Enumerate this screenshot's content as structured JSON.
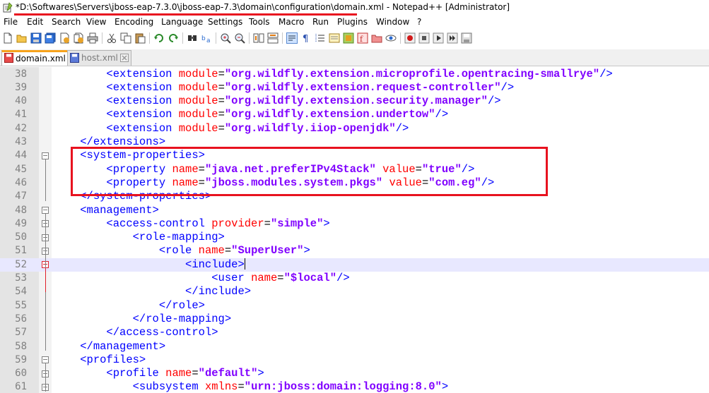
{
  "window": {
    "title": "*D:\\Softwares\\Servers\\jboss-eap-7.3.0\\jboss-eap-7.3\\domain\\configuration\\domain.xml - Notepad++ [Administrator]"
  },
  "menu": [
    "File",
    "Edit",
    "Search",
    "View",
    "Encoding",
    "Language",
    "Settings",
    "Tools",
    "Macro",
    "Run",
    "Plugins",
    "Window",
    "?"
  ],
  "tabs": [
    {
      "label": "domain.xml",
      "active": true
    },
    {
      "label": "host.xml",
      "active": false
    }
  ],
  "editor": {
    "current_line": "52",
    "lines": [
      {
        "n": "38",
        "indent": "        ",
        "parts": [
          [
            "tg",
            "<extension "
          ],
          [
            "at",
            "module"
          ],
          [
            "pl",
            "="
          ],
          [
            "vl",
            "\"org.wildfly.extension.microprofile.opentracing-smallrye\""
          ],
          [
            "tg",
            "/>"
          ]
        ]
      },
      {
        "n": "39",
        "indent": "        ",
        "parts": [
          [
            "tg",
            "<extension "
          ],
          [
            "at",
            "module"
          ],
          [
            "pl",
            "="
          ],
          [
            "vl",
            "\"org.wildfly.extension.request-controller\""
          ],
          [
            "tg",
            "/>"
          ]
        ]
      },
      {
        "n": "40",
        "indent": "        ",
        "parts": [
          [
            "tg",
            "<extension "
          ],
          [
            "at",
            "module"
          ],
          [
            "pl",
            "="
          ],
          [
            "vl",
            "\"org.wildfly.extension.security.manager\""
          ],
          [
            "tg",
            "/>"
          ]
        ]
      },
      {
        "n": "41",
        "indent": "        ",
        "parts": [
          [
            "tg",
            "<extension "
          ],
          [
            "at",
            "module"
          ],
          [
            "pl",
            "="
          ],
          [
            "vl",
            "\"org.wildfly.extension.undertow\""
          ],
          [
            "tg",
            "/>"
          ]
        ]
      },
      {
        "n": "42",
        "indent": "        ",
        "parts": [
          [
            "tg",
            "<extension "
          ],
          [
            "at",
            "module"
          ],
          [
            "pl",
            "="
          ],
          [
            "vl",
            "\"org.wildfly.iiop-openjdk\""
          ],
          [
            "tg",
            "/>"
          ]
        ]
      },
      {
        "n": "43",
        "indent": "    ",
        "parts": [
          [
            "tg",
            "</extensions>"
          ]
        ]
      },
      {
        "n": "44",
        "indent": "    ",
        "parts": [
          [
            "tg",
            "<system-properties>"
          ]
        ]
      },
      {
        "n": "45",
        "indent": "        ",
        "parts": [
          [
            "tg",
            "<property "
          ],
          [
            "at",
            "name"
          ],
          [
            "pl",
            "="
          ],
          [
            "vl",
            "\"java.net.preferIPv4Stack\""
          ],
          [
            "tg",
            " "
          ],
          [
            "at",
            "value"
          ],
          [
            "pl",
            "="
          ],
          [
            "vl",
            "\"true\""
          ],
          [
            "tg",
            "/>"
          ]
        ]
      },
      {
        "n": "46",
        "indent": "        ",
        "parts": [
          [
            "tg",
            "<property "
          ],
          [
            "at",
            "name"
          ],
          [
            "pl",
            "="
          ],
          [
            "vl",
            "\"jboss.modules.system.pkgs\""
          ],
          [
            "tg",
            " "
          ],
          [
            "at",
            "value"
          ],
          [
            "pl",
            "="
          ],
          [
            "vl",
            "\"com.eg\""
          ],
          [
            "tg",
            "/>"
          ]
        ]
      },
      {
        "n": "47",
        "indent": "    ",
        "parts": [
          [
            "tg",
            "</system-properties>"
          ]
        ]
      },
      {
        "n": "48",
        "indent": "    ",
        "parts": [
          [
            "tg",
            "<management>"
          ]
        ]
      },
      {
        "n": "49",
        "indent": "        ",
        "parts": [
          [
            "tg",
            "<access-control "
          ],
          [
            "at",
            "provider"
          ],
          [
            "pl",
            "="
          ],
          [
            "vl",
            "\"simple\""
          ],
          [
            "tg",
            ">"
          ]
        ]
      },
      {
        "n": "50",
        "indent": "            ",
        "parts": [
          [
            "tg",
            "<role-mapping>"
          ]
        ]
      },
      {
        "n": "51",
        "indent": "                ",
        "parts": [
          [
            "tg",
            "<role "
          ],
          [
            "at",
            "name"
          ],
          [
            "pl",
            "="
          ],
          [
            "vl",
            "\"SuperUser\""
          ],
          [
            "tg",
            ">"
          ]
        ]
      },
      {
        "n": "52",
        "indent": "                    ",
        "parts": [
          [
            "tg",
            "<include>"
          ]
        ]
      },
      {
        "n": "53",
        "indent": "                        ",
        "parts": [
          [
            "tg",
            "<user "
          ],
          [
            "at",
            "name"
          ],
          [
            "pl",
            "="
          ],
          [
            "vl",
            "\"$local\""
          ],
          [
            "tg",
            "/>"
          ]
        ]
      },
      {
        "n": "54",
        "indent": "                    ",
        "parts": [
          [
            "tg",
            "</include>"
          ]
        ]
      },
      {
        "n": "55",
        "indent": "                ",
        "parts": [
          [
            "tg",
            "</role>"
          ]
        ]
      },
      {
        "n": "56",
        "indent": "            ",
        "parts": [
          [
            "tg",
            "</role-mapping>"
          ]
        ]
      },
      {
        "n": "57",
        "indent": "        ",
        "parts": [
          [
            "tg",
            "</access-control>"
          ]
        ]
      },
      {
        "n": "58",
        "indent": "    ",
        "parts": [
          [
            "tg",
            "</management>"
          ]
        ]
      },
      {
        "n": "59",
        "indent": "    ",
        "parts": [
          [
            "tg",
            "<profiles>"
          ]
        ]
      },
      {
        "n": "60",
        "indent": "        ",
        "parts": [
          [
            "tg",
            "<profile "
          ],
          [
            "at",
            "name"
          ],
          [
            "pl",
            "="
          ],
          [
            "vl",
            "\"default\""
          ],
          [
            "tg",
            ">"
          ]
        ]
      },
      {
        "n": "61",
        "indent": "            ",
        "parts": [
          [
            "tg",
            "<subsystem "
          ],
          [
            "at",
            "xmlns"
          ],
          [
            "pl",
            "="
          ],
          [
            "vl",
            "\"urn:jboss:domain:logging:8.0\""
          ],
          [
            "tg",
            ">"
          ]
        ]
      }
    ]
  },
  "colors": {
    "tag": "#0000ff",
    "attribute": "#ff0000",
    "value": "#8000ff",
    "annotation": "#e8121f",
    "active_tab_accent": "#f7a21b",
    "current_line": "#e8e8ff"
  },
  "toolbar_icons": [
    "new-file-icon",
    "open-file-icon",
    "save-icon",
    "save-all-icon",
    "close-icon",
    "close-all-icon",
    "print-icon",
    "cut-icon",
    "copy-icon",
    "paste-icon",
    "undo-icon",
    "redo-icon",
    "find-icon",
    "replace-icon",
    "zoom-in-icon",
    "zoom-out-icon",
    "sync-vertical-icon",
    "sync-horizontal-icon",
    "word-wrap-icon",
    "show-all-characters-icon",
    "indent-guide-icon",
    "document-map-icon",
    "function-list-icon",
    "folder-as-workspace-icon",
    "monitoring-icon",
    "record-macro-icon",
    "stop-recording-icon",
    "playback-macro-icon",
    "run-macro-multiple-icon",
    "save-macro-icon"
  ]
}
